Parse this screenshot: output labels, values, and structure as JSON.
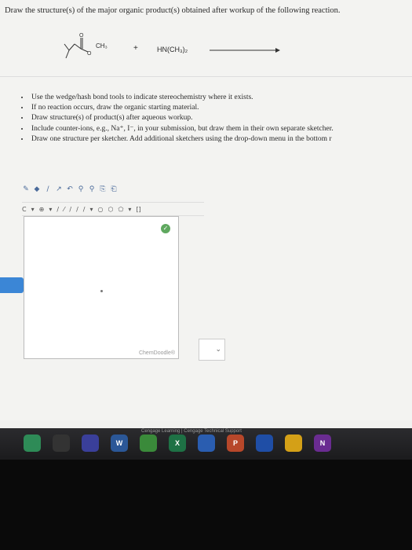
{
  "question": {
    "prompt": "Draw the structure(s) of the major organic product(s) obtained after workup of the following reaction."
  },
  "reaction": {
    "reactant_label": "CH₃",
    "plus": "+",
    "reagent": "HN(CH₃)₂"
  },
  "instructions": [
    "Use the wedge/hash bond tools to indicate stereochemistry where it exists.",
    "If no reaction occurs, draw the organic starting material.",
    "Draw structure(s) of product(s) after aqueous workup.",
    "Include counter-ions, e.g., Na⁺, I⁻, in your submission, but draw them in their own separate sketcher.",
    "Draw one structure per sketcher. Add additional sketchers using the drop-down menu in the bottom r"
  ],
  "toolbar": {
    "row1_icons": [
      "pencil-icon",
      "eraser-icon",
      "lasso-icon",
      "arrow-icon",
      "zoom-in-icon",
      "zoom-out-icon",
      "copy-icon",
      "paste-icon"
    ],
    "row2": [
      "C",
      "▾",
      "⊕",
      "▾",
      "/",
      "⁄",
      "/",
      "/",
      "/",
      "▾",
      "○",
      "⬡",
      "⬠",
      "▾",
      "[]"
    ]
  },
  "sketcher": {
    "brand": "ChemDoodle®"
  },
  "dock": {
    "label": "Cengage Learning | Cengage Technical Support",
    "icons": [
      {
        "name": "finder-icon",
        "text": "",
        "color": "#2e8b57"
      },
      {
        "name": "cursor-icon",
        "text": "",
        "color": "#333"
      },
      {
        "name": "help-icon",
        "text": "",
        "color": "#3a3f9a"
      },
      {
        "name": "word-icon",
        "text": "W",
        "color": "#2b5797"
      },
      {
        "name": "chrome-icon",
        "text": "",
        "color": "#3a8a3a"
      },
      {
        "name": "excel-icon",
        "text": "X",
        "color": "#1e7145"
      },
      {
        "name": "firefox-icon",
        "text": "",
        "color": "#2a5db0"
      },
      {
        "name": "powerpoint-icon",
        "text": "P",
        "color": "#b7472a"
      },
      {
        "name": "blue-app-icon",
        "text": "",
        "color": "#1f4ea6"
      },
      {
        "name": "chrome-icon-2",
        "text": "",
        "color": "#d4a017"
      },
      {
        "name": "onenote-icon",
        "text": "N",
        "color": "#6a2c91"
      }
    ]
  }
}
